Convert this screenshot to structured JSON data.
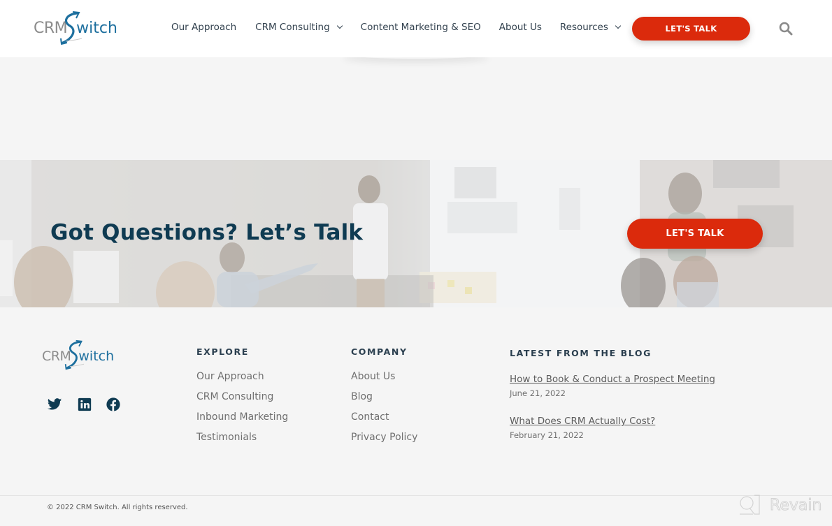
{
  "header": {
    "logo": {
      "part1": "CRM",
      "part2": "witch",
      "alt": "CRMSwitch"
    },
    "nav": [
      {
        "label": "Our Approach",
        "has_dropdown": false
      },
      {
        "label": "CRM Consulting",
        "has_dropdown": true
      },
      {
        "label": "Content Marketing & SEO",
        "has_dropdown": false
      },
      {
        "label": "About Us",
        "has_dropdown": false
      },
      {
        "label": "Resources",
        "has_dropdown": true
      }
    ],
    "cta_label": "LET'S TALK",
    "search_icon": "search-icon"
  },
  "cta_band": {
    "title": "Got Questions? Let’s Talk",
    "button_label": "LET'S TALK"
  },
  "footer": {
    "logo": {
      "part1": "CRM",
      "part2": "witch"
    },
    "social": [
      "twitter-icon",
      "linkedin-icon",
      "facebook-icon"
    ],
    "explore": {
      "heading": "EXPLORE",
      "links": [
        "Our Approach",
        "CRM Consulting",
        "Inbound Marketing",
        "Testimonials"
      ]
    },
    "company": {
      "heading": "COMPANY",
      "links": [
        "About Us",
        "Blog",
        "Contact",
        "Privacy Policy"
      ]
    },
    "blog": {
      "heading": "LATEST FROM THE BLOG",
      "posts": [
        {
          "title": "How to Book & Conduct a Prospect Meeting",
          "date": "June 21, 2022"
        },
        {
          "title": "What Does CRM Actually Cost?",
          "date": "February 21, 2022"
        }
      ]
    },
    "copyright": "© 2022 CRM Switch. All rights reserved.",
    "watermark": "Revain"
  },
  "colors": {
    "accent_red": "#db2a0c",
    "brand_blue": "#1d6f9e",
    "heading_navy": "#0f3b52"
  }
}
